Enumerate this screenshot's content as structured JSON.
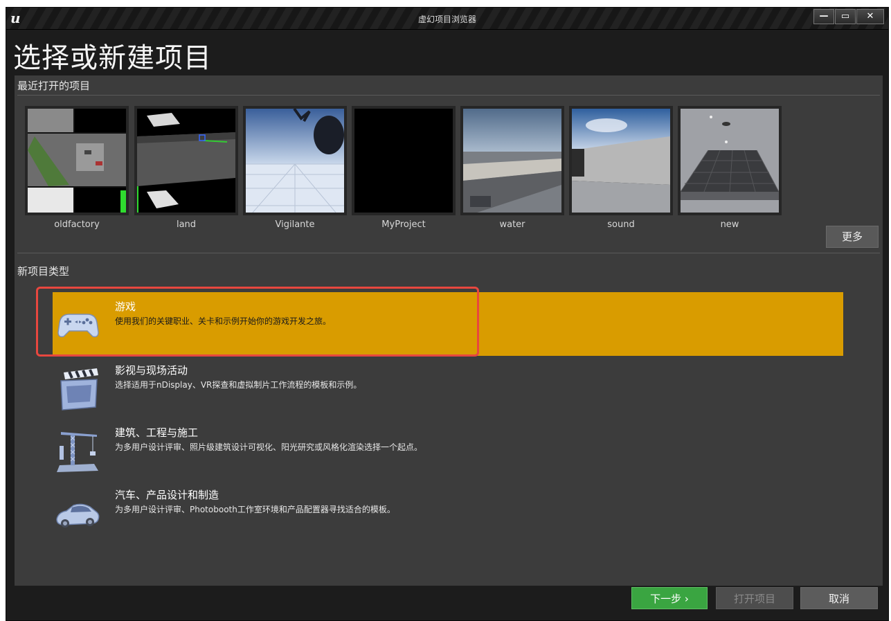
{
  "window": {
    "title": "虚幻项目浏览器",
    "controls": {
      "minimize": "—",
      "maximize": "▭",
      "close": "✕"
    }
  },
  "page_title": "选择或新建项目",
  "recent": {
    "label": "最近打开的项目",
    "more_label": "更多",
    "projects": [
      {
        "name": "oldfactory"
      },
      {
        "name": "land"
      },
      {
        "name": "Vigilante"
      },
      {
        "name": "MyProject"
      },
      {
        "name": "water"
      },
      {
        "name": "sound"
      },
      {
        "name": "new"
      }
    ]
  },
  "new_types": {
    "label": "新项目类型",
    "items": [
      {
        "title": "游戏",
        "desc": "使用我们的关键职业、关卡和示例开始你的游戏开发之旅。",
        "icon": "gamepad-icon",
        "selected": true
      },
      {
        "title": "影视与现场活动",
        "desc": "选择适用于nDisplay、VR探查和虚拟制片工作流程的模板和示例。",
        "icon": "clapperboard-icon",
        "selected": false
      },
      {
        "title": "建筑、工程与施工",
        "desc": "为多用户设计评审、照片级建筑设计可视化、阳光研究或风格化渲染选择一个起点。",
        "icon": "crane-icon",
        "selected": false
      },
      {
        "title": "汽车、产品设计和制造",
        "desc": "为多用户设计评审、Photobooth工作室环境和产品配置器寻找适合的模板。",
        "icon": "car-icon",
        "selected": false
      }
    ]
  },
  "footer": {
    "next": "下一步 ›",
    "open": "打开项目",
    "cancel": "取消"
  },
  "colors": {
    "selected_bg": "#d99c00",
    "next_button": "#3aa541",
    "highlight_border": "#e8473f"
  }
}
